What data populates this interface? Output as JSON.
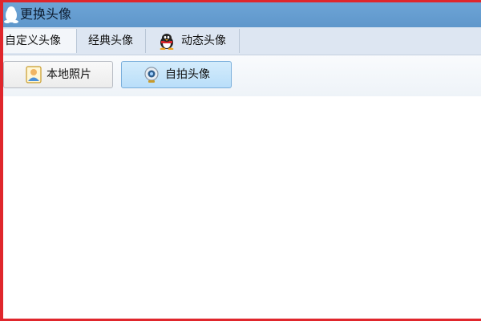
{
  "window": {
    "title": "更换头像",
    "title_icon": "qq-penguin-icon",
    "frame_color": "#e0262c",
    "titlebar_color": "#5f97cb"
  },
  "tabs": [
    {
      "label": "自定义头像",
      "active": true
    },
    {
      "label": "经典头像",
      "active": false
    },
    {
      "label": "动态头像",
      "active": false,
      "icon": "qq-penguin-color-icon"
    }
  ],
  "toolbar": {
    "local_photo": {
      "label": "本地照片",
      "icon": "person-photo-icon"
    },
    "selfie": {
      "label": "自拍头像",
      "icon": "webcam-icon",
      "selected": true
    }
  }
}
